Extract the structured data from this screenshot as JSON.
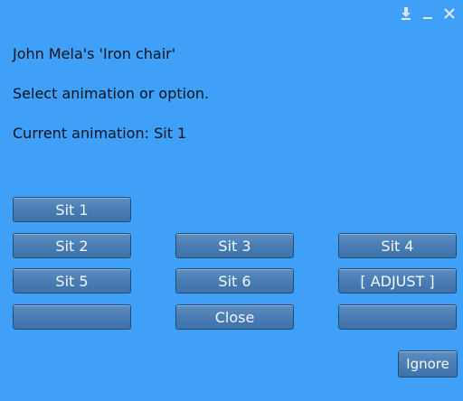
{
  "window": {
    "controls": [
      {
        "name": "dock-icon"
      },
      {
        "name": "minimize-icon"
      },
      {
        "name": "close-icon"
      }
    ]
  },
  "dialog": {
    "owner_line": "John Mela's 'Iron chair'",
    "prompt": "Select animation or option.",
    "current": "Current animation: Sit 1"
  },
  "buttons": {
    "sit1": "Sit 1",
    "sit2": "Sit 2",
    "sit3": "Sit 3",
    "sit4": "Sit 4",
    "sit5": "Sit 5",
    "sit6": "Sit 6",
    "adjust": "[ ADJUST ]",
    "blank_left": "",
    "close": "Close",
    "blank_right": "",
    "ignore": "Ignore"
  },
  "colors": {
    "background": "#40a0f8",
    "button": "#4a7db3",
    "button_border": "#1e4d7a",
    "button_text": "#f2f7fc"
  }
}
